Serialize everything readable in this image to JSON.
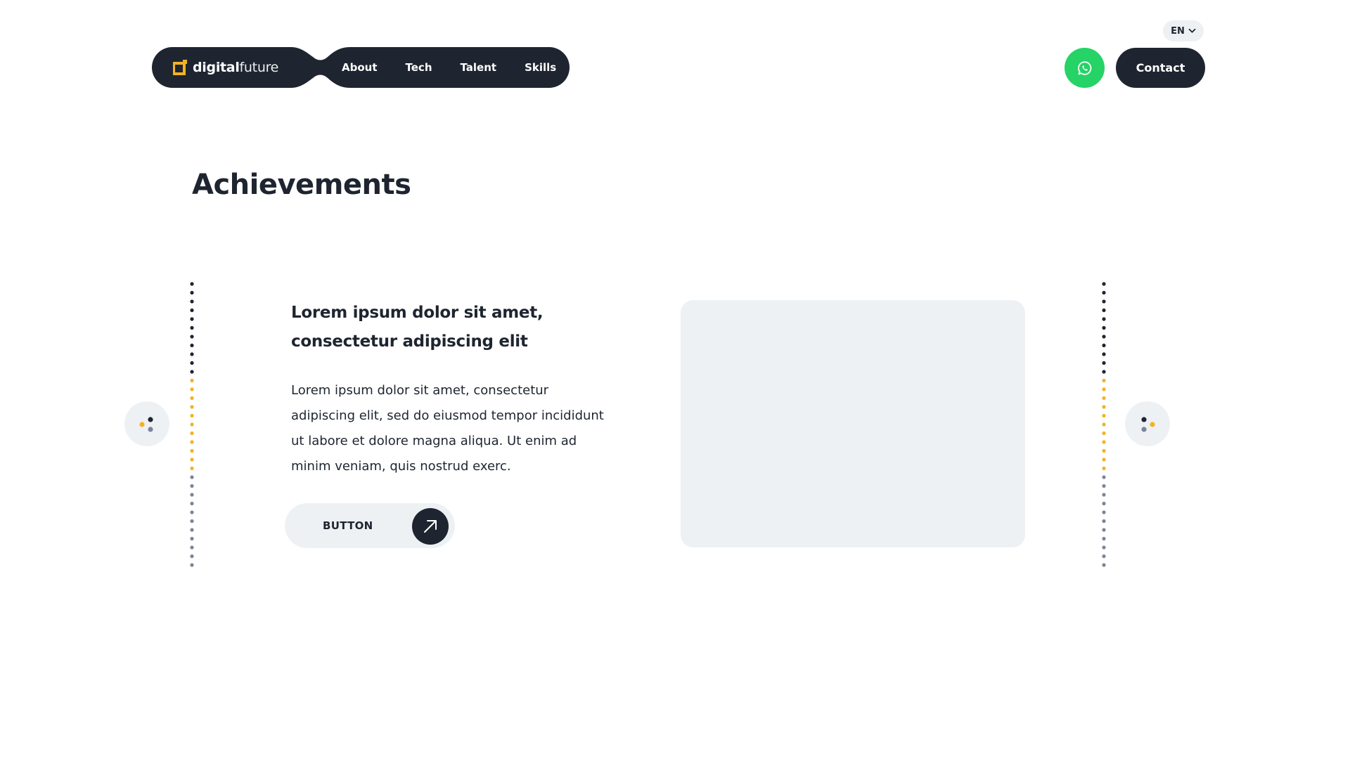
{
  "header": {
    "language": "EN",
    "logo": {
      "text_strong": "digital",
      "text_light": "future"
    },
    "nav_items": [
      {
        "label": "About"
      },
      {
        "label": "Tech"
      },
      {
        "label": "Talent"
      },
      {
        "label": "Skills"
      }
    ],
    "contact_label": "Contact"
  },
  "section": {
    "title": "Achievements"
  },
  "slide": {
    "heading": "Lorem ipsum dolor sit amet, consectetur adipiscing elit",
    "body": "Lorem ipsum dolor sit amet, consectetur adipiscing elit, sed do eiusmod tempor incididunt ut labore et dolore magna aliqua. Ut enim ad minim veniam, quis nostrud exerc.",
    "button_label": "BUTTON"
  },
  "icons": {
    "lang": "chevron-down-icon",
    "whatsapp": "whatsapp-icon",
    "slide_button": "arrow-up-right-icon",
    "prev": "dots-icon",
    "next": "dots-icon"
  },
  "colors": {
    "navy": "#1e2530",
    "accent": "#f4b223",
    "muted": "#7b8598",
    "whatsapp": "#25d366",
    "surface": "#eef1f4"
  }
}
